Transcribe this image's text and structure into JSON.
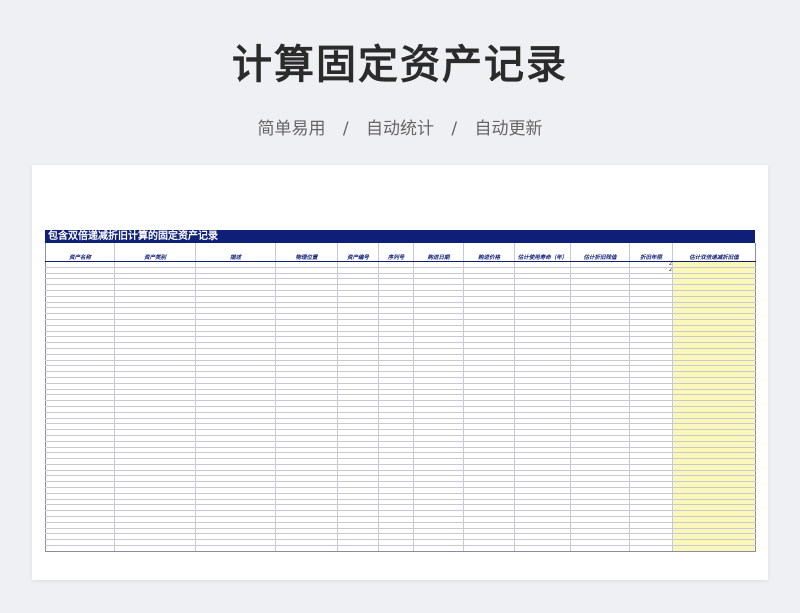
{
  "page": {
    "title": "计算固定资产记录",
    "subtitle_parts": [
      "简单易用",
      "自动统计",
      "自动更新"
    ],
    "separator": "/"
  },
  "sheet": {
    "title": "包含双倍递减折旧计算的固定资产记录",
    "headers": [
      "资产名称",
      "资产类别",
      "描述",
      "物理位置",
      "资产编号",
      "序列号",
      "购进日期",
      "购进价格",
      "估计使用寿命（年）",
      "估计折旧残值",
      "折旧年限",
      "估计双倍递减折旧值"
    ],
    "row_count": 50,
    "cells": [
      {
        "row": 0,
        "col": 10,
        "value": "2"
      },
      {
        "row": 1,
        "col": 10,
        "value": "2"
      }
    ],
    "highlight_color": "#fbf7b9",
    "header_color": "#0f1f78"
  }
}
